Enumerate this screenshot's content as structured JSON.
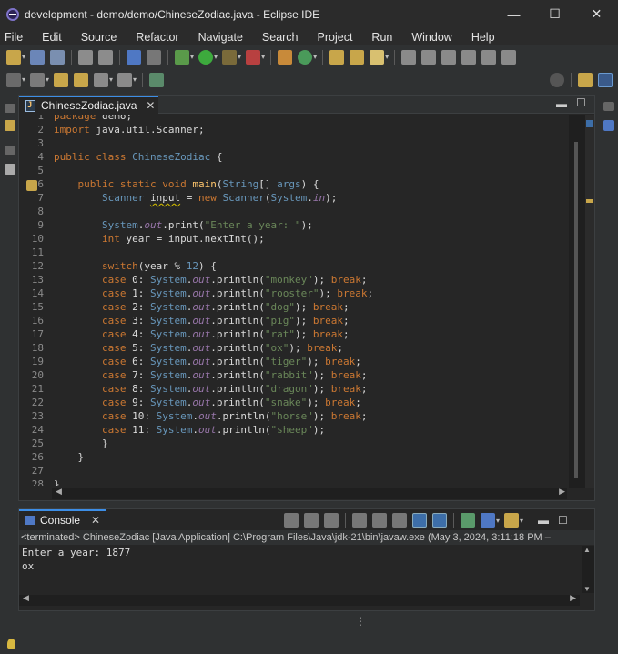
{
  "window": {
    "title": "development - demo/demo/ChineseZodiac.java - Eclipse IDE",
    "minimize": "—",
    "maximize": "☐",
    "close": "✕"
  },
  "menu": [
    "File",
    "Edit",
    "Source",
    "Refactor",
    "Navigate",
    "Search",
    "Project",
    "Run",
    "Window",
    "Help"
  ],
  "editor": {
    "tab_label": "ChineseZodiac.java",
    "tab_close": "✕",
    "lines": [
      {
        "n": "1",
        "h": "<span class=\"kw\">package</span> demo;"
      },
      {
        "n": "2",
        "h": "<span class=\"kw\">import</span> java.util.Scanner;"
      },
      {
        "n": "3",
        "h": ""
      },
      {
        "n": "4",
        "h": "<span class=\"kw\">public class</span> <span class=\"ty\">ChineseZodiac</span> {"
      },
      {
        "n": "5",
        "h": ""
      },
      {
        "n": "6",
        "h": "    <span class=\"kw\">public static void</span> <span class=\"md\">main</span>(<span class=\"ty\">String</span>[] <span class=\"ty\">args</span>) {"
      },
      {
        "n": "7",
        "h": "        <span class=\"ty\">Scanner</span> <span class=\"ul\">input</span> = <span class=\"kw\">new</span> <span class=\"ty\">Scanner</span>(<span class=\"ty\">System</span>.<span class=\"fl\">in</span>);"
      },
      {
        "n": "8",
        "h": ""
      },
      {
        "n": "9",
        "h": "        <span class=\"ty\">System</span>.<span class=\"fl\">out</span>.print(<span class=\"st\">\"Enter a year: \"</span>);"
      },
      {
        "n": "10",
        "h": "        <span class=\"kw\">int</span> year = input.nextInt();"
      },
      {
        "n": "11",
        "h": ""
      },
      {
        "n": "12",
        "h": "        <span class=\"kw\">switch</span>(year % <span class=\"ty\">12</span>) {"
      },
      {
        "n": "13",
        "h": "        <span class=\"kw\">case</span> 0: <span class=\"ty\">System</span>.<span class=\"fl\">out</span>.println(<span class=\"st\">\"monkey\"</span>); <span class=\"kw\">break</span>;"
      },
      {
        "n": "14",
        "h": "        <span class=\"kw\">case</span> 1: <span class=\"ty\">System</span>.<span class=\"fl\">out</span>.println(<span class=\"st\">\"rooster\"</span>); <span class=\"kw\">break</span>;"
      },
      {
        "n": "15",
        "h": "        <span class=\"kw\">case</span> 2: <span class=\"ty\">System</span>.<span class=\"fl\">out</span>.println(<span class=\"st\">\"dog\"</span>); <span class=\"kw\">break</span>;"
      },
      {
        "n": "16",
        "h": "        <span class=\"kw\">case</span> 3: <span class=\"ty\">System</span>.<span class=\"fl\">out</span>.println(<span class=\"st\">\"pig\"</span>); <span class=\"kw\">break</span>;"
      },
      {
        "n": "17",
        "h": "        <span class=\"kw\">case</span> 4: <span class=\"ty\">System</span>.<span class=\"fl\">out</span>.println(<span class=\"st\">\"rat\"</span>); <span class=\"kw\">break</span>;"
      },
      {
        "n": "18",
        "h": "        <span class=\"kw\">case</span> 5: <span class=\"ty\">System</span>.<span class=\"fl\">out</span>.println(<span class=\"st\">\"ox\"</span>); <span class=\"kw\">break</span>;"
      },
      {
        "n": "19",
        "h": "        <span class=\"kw\">case</span> 6: <span class=\"ty\">System</span>.<span class=\"fl\">out</span>.println(<span class=\"st\">\"tiger\"</span>); <span class=\"kw\">break</span>;"
      },
      {
        "n": "20",
        "h": "        <span class=\"kw\">case</span> 7: <span class=\"ty\">System</span>.<span class=\"fl\">out</span>.println(<span class=\"st\">\"rabbit\"</span>); <span class=\"kw\">break</span>;"
      },
      {
        "n": "21",
        "h": "        <span class=\"kw\">case</span> 8: <span class=\"ty\">System</span>.<span class=\"fl\">out</span>.println(<span class=\"st\">\"dragon\"</span>); <span class=\"kw\">break</span>;"
      },
      {
        "n": "22",
        "h": "        <span class=\"kw\">case</span> 9: <span class=\"ty\">System</span>.<span class=\"fl\">out</span>.println(<span class=\"st\">\"snake\"</span>); <span class=\"kw\">break</span>;"
      },
      {
        "n": "23",
        "h": "        <span class=\"kw\">case</span> 10: <span class=\"ty\">System</span>.<span class=\"fl\">out</span>.println(<span class=\"st\">\"horse\"</span>); <span class=\"kw\">break</span>;"
      },
      {
        "n": "24",
        "h": "        <span class=\"kw\">case</span> 11: <span class=\"ty\">System</span>.<span class=\"fl\">out</span>.println(<span class=\"st\">\"sheep\"</span>);"
      },
      {
        "n": "25",
        "h": "        }"
      },
      {
        "n": "26",
        "h": "    }"
      },
      {
        "n": "27",
        "h": ""
      },
      {
        "n": "28",
        "h": "}"
      }
    ]
  },
  "console": {
    "tab_label": "Console",
    "tab_close": "✕",
    "status": "<terminated> ChineseZodiac [Java Application] C:\\Program Files\\Java\\jdk-21\\bin\\javaw.exe  (May 3, 2024, 3:11:18 PM –",
    "output": "Enter a year: 1877\nox"
  },
  "colors": {
    "accent": "#3d8ee6",
    "keyword": "#cc7832",
    "string": "#6a8759",
    "type": "#6897bb",
    "field": "#9876aa"
  }
}
